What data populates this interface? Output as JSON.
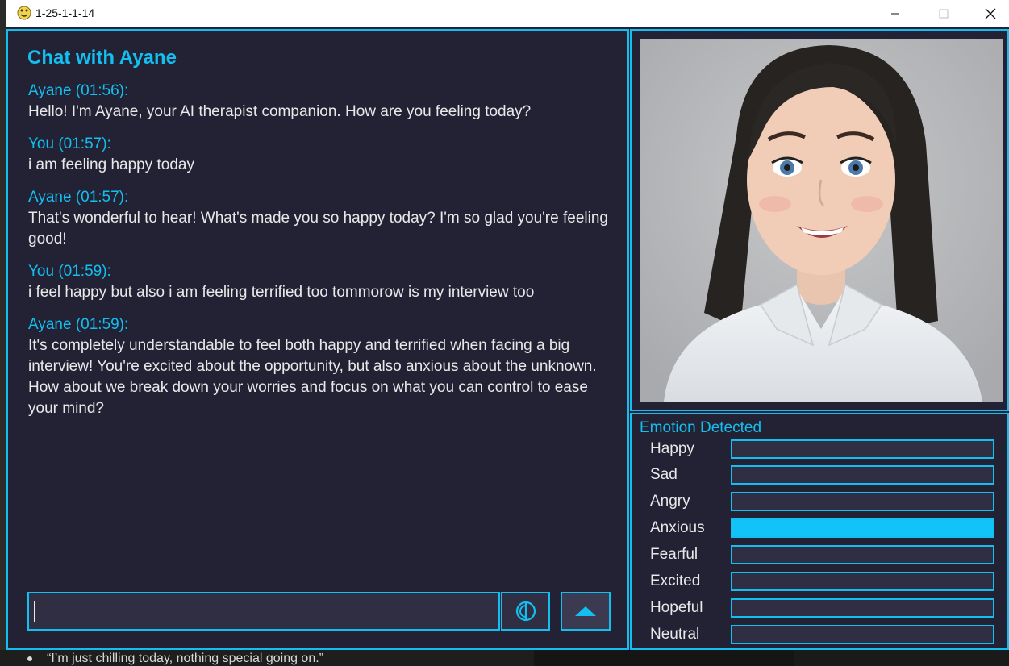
{
  "window": {
    "title": "1-25-1-1-14"
  },
  "background": {
    "bullet_text": "“I’m just chilling today, nothing special going on.”"
  },
  "chat": {
    "title": "Chat with Ayane",
    "messages": [
      {
        "speaker": "Ayane (01:56):",
        "text": "Hello! I'm Ayane, your AI therapist companion. How are you feeling today?"
      },
      {
        "speaker": "You (01:57):",
        "text": "i am feeling happy today"
      },
      {
        "speaker": "Ayane (01:57):",
        "text": "That's wonderful to hear! What's made you so happy today? I'm so glad you're feeling good!"
      },
      {
        "speaker": "You (01:59):",
        "text": "i feel happy but also i am feeling terrified too tommorow is my interview too"
      },
      {
        "speaker": "Ayane (01:59):",
        "text": "It's completely understandable to feel both happy and terrified when facing a big interview! You're excited about the opportunity, but also anxious about the unknown. How about we break down your worries and focus on what you can control to ease your mind?"
      }
    ],
    "input_value": "",
    "mic_icon": "mic-toggle-icon",
    "send_icon": "up-arrow-icon"
  },
  "emotions": {
    "heading": "Emotion Detected",
    "items": [
      {
        "label": "Happy",
        "level": 0
      },
      {
        "label": "Sad",
        "level": 0
      },
      {
        "label": "Angry",
        "level": 0
      },
      {
        "label": "Anxious",
        "level": 1
      },
      {
        "label": "Fearful",
        "level": 0
      },
      {
        "label": "Excited",
        "level": 0
      },
      {
        "label": "Hopeful",
        "level": 0
      },
      {
        "label": "Neutral",
        "level": 0
      }
    ]
  },
  "colors": {
    "accent": "#12bff0",
    "panel_bg": "#232235",
    "input_bg": "#2f2e42",
    "text": "#e8e8e8"
  }
}
